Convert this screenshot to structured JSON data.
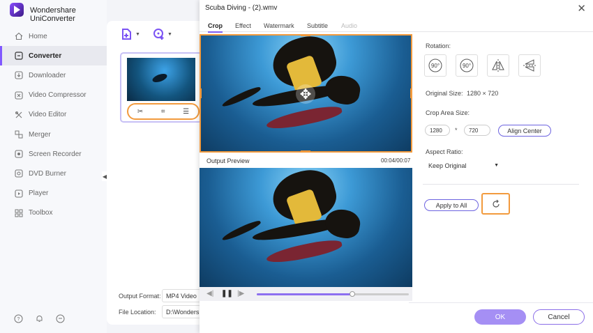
{
  "app": {
    "title": "Wondershare UniConverter"
  },
  "sidebar": {
    "items": [
      {
        "label": "Home",
        "icon": "home-icon"
      },
      {
        "label": "Converter",
        "icon": "converter-icon",
        "active": true
      },
      {
        "label": "Downloader",
        "icon": "download-icon"
      },
      {
        "label": "Video Compressor",
        "icon": "compress-icon"
      },
      {
        "label": "Video Editor",
        "icon": "edit-icon"
      },
      {
        "label": "Merger",
        "icon": "merge-icon"
      },
      {
        "label": "Screen Recorder",
        "icon": "record-icon"
      },
      {
        "label": "DVD Burner",
        "icon": "dvd-icon"
      },
      {
        "label": "Player",
        "icon": "play-icon"
      },
      {
        "label": "Toolbox",
        "icon": "grid-icon"
      }
    ]
  },
  "main": {
    "output_format_label": "Output Format:",
    "output_format_value": "MP4 Video",
    "file_location_label": "File Location:",
    "file_location_value": "D:\\Wondershare"
  },
  "dialog": {
    "title": "Scuba Diving - (2).wmv",
    "tabs": [
      "Crop",
      "Effect",
      "Watermark",
      "Subtitle",
      "Audio"
    ],
    "output_preview_label": "Output Preview",
    "time": "00:04/00:07",
    "progress": 0.63,
    "rotation_label": "Rotation:",
    "rotate_left_text": "90°",
    "rotate_right_text": "90°",
    "original_size_label": "Original Size:",
    "original_size_value": "1280 × 720",
    "crop_area_label": "Crop Area Size:",
    "crop_width": "1280",
    "crop_times": "*",
    "crop_height": "720",
    "align_center_label": "Align Center",
    "aspect_ratio_label": "Aspect Ratio:",
    "aspect_ratio_value": "Keep Original",
    "apply_all_label": "Apply to All",
    "ok_label": "OK",
    "cancel_label": "Cancel"
  },
  "colors": {
    "accent": "#7e5cf0",
    "highlight": "#f29a3d"
  }
}
